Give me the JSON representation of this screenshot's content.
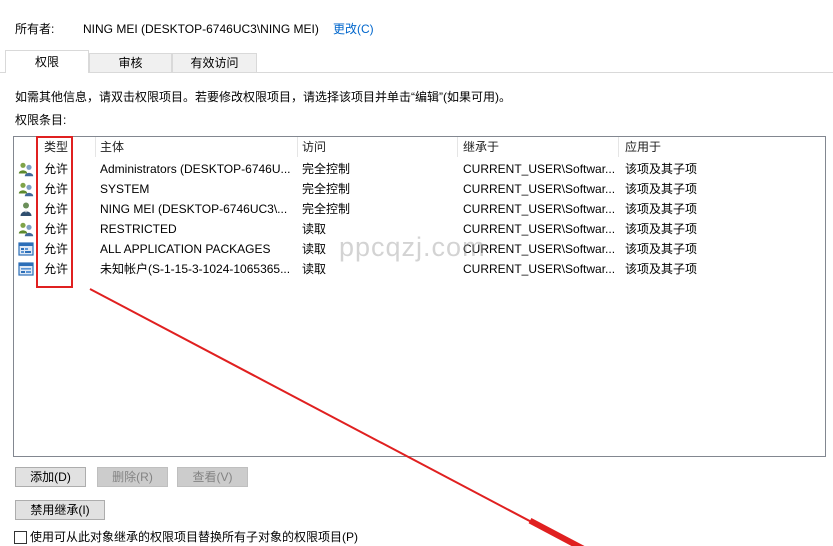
{
  "owner": {
    "label": "所有者:",
    "value": "NING MEI (DESKTOP-6746UC3\\NING MEI)",
    "change_link": "更改(C)"
  },
  "tabs": [
    {
      "label": "权限",
      "selected": true
    },
    {
      "label": "审核",
      "selected": false
    },
    {
      "label": "有效访问",
      "selected": false
    }
  ],
  "info_text": "如需其他信息，请双击权限项目。若要修改权限项目，请选择该项目并单击“编辑”(如果可用)。",
  "entries_label": "权限条目:",
  "table": {
    "columns": [
      "类型",
      "主体",
      "访问",
      "继承于",
      "应用于"
    ],
    "rows": [
      {
        "icon": "user-group-icon",
        "type": "允许",
        "principal": "Administrators (DESKTOP-6746U...",
        "access": "完全控制",
        "inherited_from": "CURRENT_USER\\Softwar...",
        "applies_to": "该项及其子项"
      },
      {
        "icon": "user-group-icon",
        "type": "允许",
        "principal": "SYSTEM",
        "access": "完全控制",
        "inherited_from": "CURRENT_USER\\Softwar...",
        "applies_to": "该项及其子项"
      },
      {
        "icon": "user-icon",
        "type": "允许",
        "principal": "NING MEI (DESKTOP-6746UC3\\...",
        "access": "完全控制",
        "inherited_from": "CURRENT_USER\\Softwar...",
        "applies_to": "该项及其子项"
      },
      {
        "icon": "user-group-icon",
        "type": "允许",
        "principal": "RESTRICTED",
        "access": "读取",
        "inherited_from": "CURRENT_USER\\Softwar...",
        "applies_to": "该项及其子项"
      },
      {
        "icon": "app-package-icon",
        "type": "允许",
        "principal": "ALL APPLICATION PACKAGES",
        "access": "读取",
        "inherited_from": "CURRENT_USER\\Softwar...",
        "applies_to": "该项及其子项"
      },
      {
        "icon": "app-package-icon",
        "type": "允许",
        "principal": "未知帐户(S-1-15-3-1024-1065365...",
        "access": "读取",
        "inherited_from": "CURRENT_USER\\Softwar...",
        "applies_to": "该项及其子项"
      }
    ]
  },
  "buttons": {
    "add": {
      "label": "添加(D)",
      "enabled": true
    },
    "remove": {
      "label": "删除(R)",
      "enabled": false
    },
    "view": {
      "label": "查看(V)",
      "enabled": false
    },
    "disable_inheritance": {
      "label": "禁用继承(I)",
      "enabled": true
    }
  },
  "checkbox": {
    "label": "使用可从此对象继承的权限项目替换所有子对象的权限项目(P)",
    "checked": false
  },
  "watermark": "ppcqzj.com",
  "colors": {
    "link": "#0066cc",
    "annotation": "#e02020",
    "disabled_text": "#838383"
  }
}
